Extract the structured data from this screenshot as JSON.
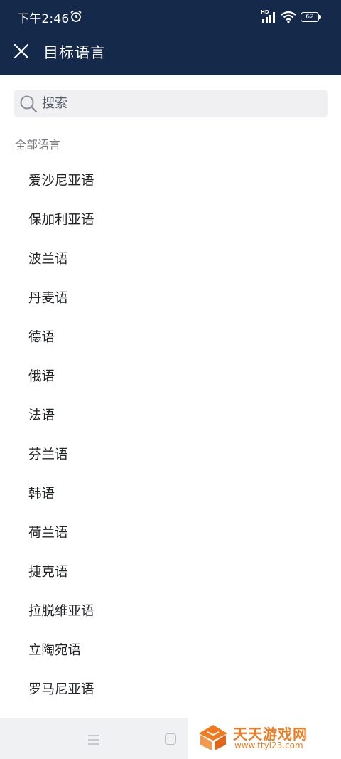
{
  "status_bar": {
    "time": "下午2:46",
    "network": "HD",
    "battery": "62"
  },
  "app_bar": {
    "title": "目标语言"
  },
  "search": {
    "placeholder": "搜索"
  },
  "section": {
    "header": "全部语言"
  },
  "languages": [
    "爱沙尼亚语",
    "保加利亚语",
    "波兰语",
    "丹麦语",
    "德语",
    "俄语",
    "法语",
    "芬兰语",
    "韩语",
    "荷兰语",
    "捷克语",
    "拉脱维亚语",
    "立陶宛语",
    "罗马尼亚语"
  ],
  "watermark": {
    "title": "天天游戏网",
    "url": "www.ttyl23.com"
  },
  "colors": {
    "header_bg": "#15294a",
    "watermark": "#f07a1f"
  }
}
